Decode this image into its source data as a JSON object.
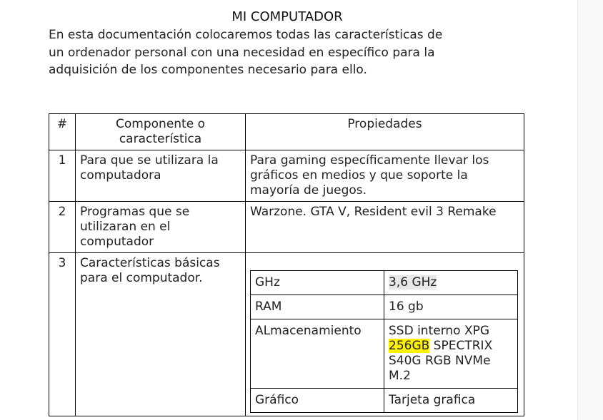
{
  "document": {
    "title": "MI COMPUTADOR",
    "intro_lines": [
      "En esta documentación colocaremos todas las características de",
      "un ordenador personal con una necesidad en específico para la",
      "adquisición de los componentes necesario para ello."
    ]
  },
  "table": {
    "headers": {
      "num": "#",
      "component_line1": "Componente o",
      "component_line2": "característica",
      "properties": "Propiedades"
    },
    "rows": [
      {
        "num": "1",
        "component": "Para que se utilizara la computadora",
        "properties": "Para gaming específicamente llevar los gráficos en medios y que soporte la mayoría de juegos."
      },
      {
        "num": "2",
        "component": "Programas que se utilizaran en el computador",
        "properties": "Warzone. GTA V, Resident evil 3 Remake"
      },
      {
        "num": "3",
        "component": "Características básicas para el computador."
      }
    ],
    "specs": [
      {
        "key": "GHz",
        "value": "3,6 GHz"
      },
      {
        "key": "RAM",
        "value": "16 gb"
      },
      {
        "key": "ALmacenamiento",
        "value_pre": "SSD interno XPG ",
        "value_highlight": "256GB",
        "value_post": " SPECTRIX S40G RGB NVMe M.2"
      },
      {
        "key": "Gráfico",
        "value": "Tarjeta grafica"
      }
    ]
  },
  "colors": {
    "highlight_yellow": "#fff200",
    "highlight_gray": "#e8e8e8",
    "gutter": "#f8f9fa"
  }
}
